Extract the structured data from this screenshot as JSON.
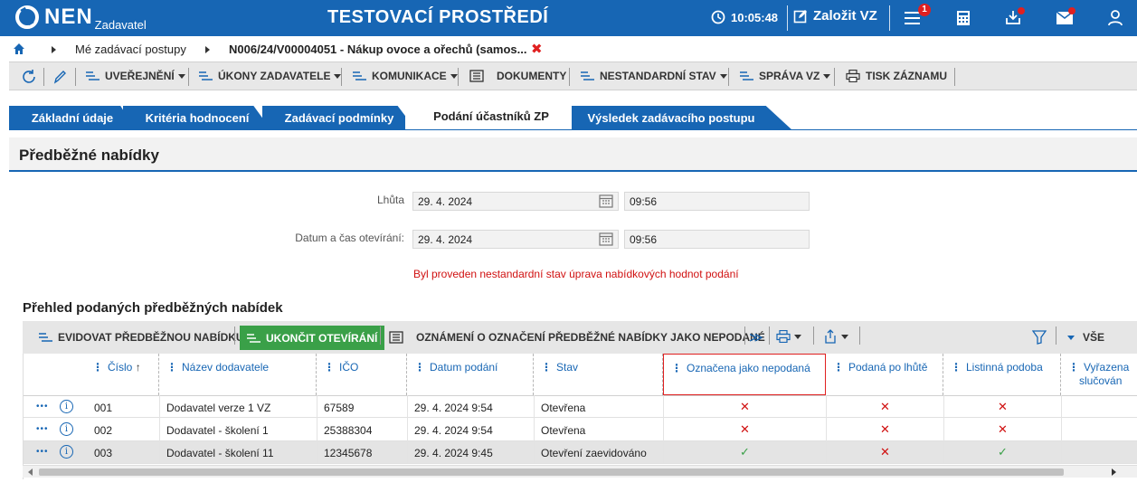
{
  "header": {
    "logo_text": "NEN",
    "logo_sub": "Zadavatel",
    "env_title": "TESTOVACÍ PROSTŘEDÍ",
    "clock": "10:05:48",
    "create_label": "Založit VZ",
    "notification_count": "1"
  },
  "breadcrumb": {
    "items": [
      "Mé zadávací postupy",
      "N006/24/V00004051 - Nákup ovoce a ořechů (samos..."
    ],
    "close": "✖"
  },
  "toolbar": {
    "items": [
      "UVEŘEJNĚNÍ",
      "ÚKONY ZADAVATELE",
      "KOMUNIKACE",
      "DOKUMENTY",
      "NESTANDARDNÍ STAV",
      "SPRÁVA VZ",
      "TISK ZÁZNAMU"
    ]
  },
  "tabs": [
    "Základní údaje",
    "Kritéria hodnocení",
    "Zadávací podmínky",
    "Podání účastníků ZP",
    "Výsledek zadávacího postupu"
  ],
  "section": {
    "title": "Předběžné nabídky",
    "lhuta_label": "Lhůta",
    "lhuta_date": "29. 4. 2024",
    "lhuta_time": "09:56",
    "otevirani_label": "Datum a čas otevírání:",
    "otevirani_date": "29. 4. 2024",
    "otevirani_time": "09:56",
    "warning": "Byl proveden nestandardní stav úprava nabídkových hodnot podání"
  },
  "grid": {
    "title": "Přehled podaných předběžných nabídek",
    "toolbar": {
      "evidovat": "EVIDOVAT PŘEDBĚŽNOU NABÍDKU",
      "ukoncit": "UKONČIT OTEVÍRÁNÍ",
      "oznameni": "OZNÁMENÍ O OZNAČENÍ PŘEDBĚŽNÉ NABÍDKY JAKO NEPODANÉ",
      "more": "≫",
      "filter_all": "VŠE"
    },
    "columns": [
      "Číslo",
      "Název dodavatele",
      "IČO",
      "Datum podání",
      "Stav",
      "Označena jako nepodaná",
      "Podaná po lhůtě",
      "Listinná podoba",
      "Vyřazena",
      "slučován"
    ],
    "sort_indicator": "↑",
    "rows": [
      {
        "cislo": "001",
        "nazev": "Dodavatel verze 1 VZ",
        "ico": "67589",
        "datum": "29. 4. 2024 9:54",
        "stav": "Otevřena",
        "nepodana": "✕",
        "po_lhute": "✕",
        "listinna": "✕"
      },
      {
        "cislo": "002",
        "nazev": "Dodavatel - školení 1",
        "ico": "25388304",
        "datum": "29. 4. 2024 9:54",
        "stav": "Otevřena",
        "nepodana": "✕",
        "po_lhute": "✕",
        "listinna": "✕"
      },
      {
        "cislo": "003",
        "nazev": "Dodavatel - školení 11",
        "ico": "12345678",
        "datum": "29. 4. 2024 9:45",
        "stav": "Otevření zaevidováno",
        "nepodana": "✓",
        "po_lhute": "✕",
        "listinna": "✓"
      }
    ],
    "row_menu": "•••",
    "info": "i"
  }
}
